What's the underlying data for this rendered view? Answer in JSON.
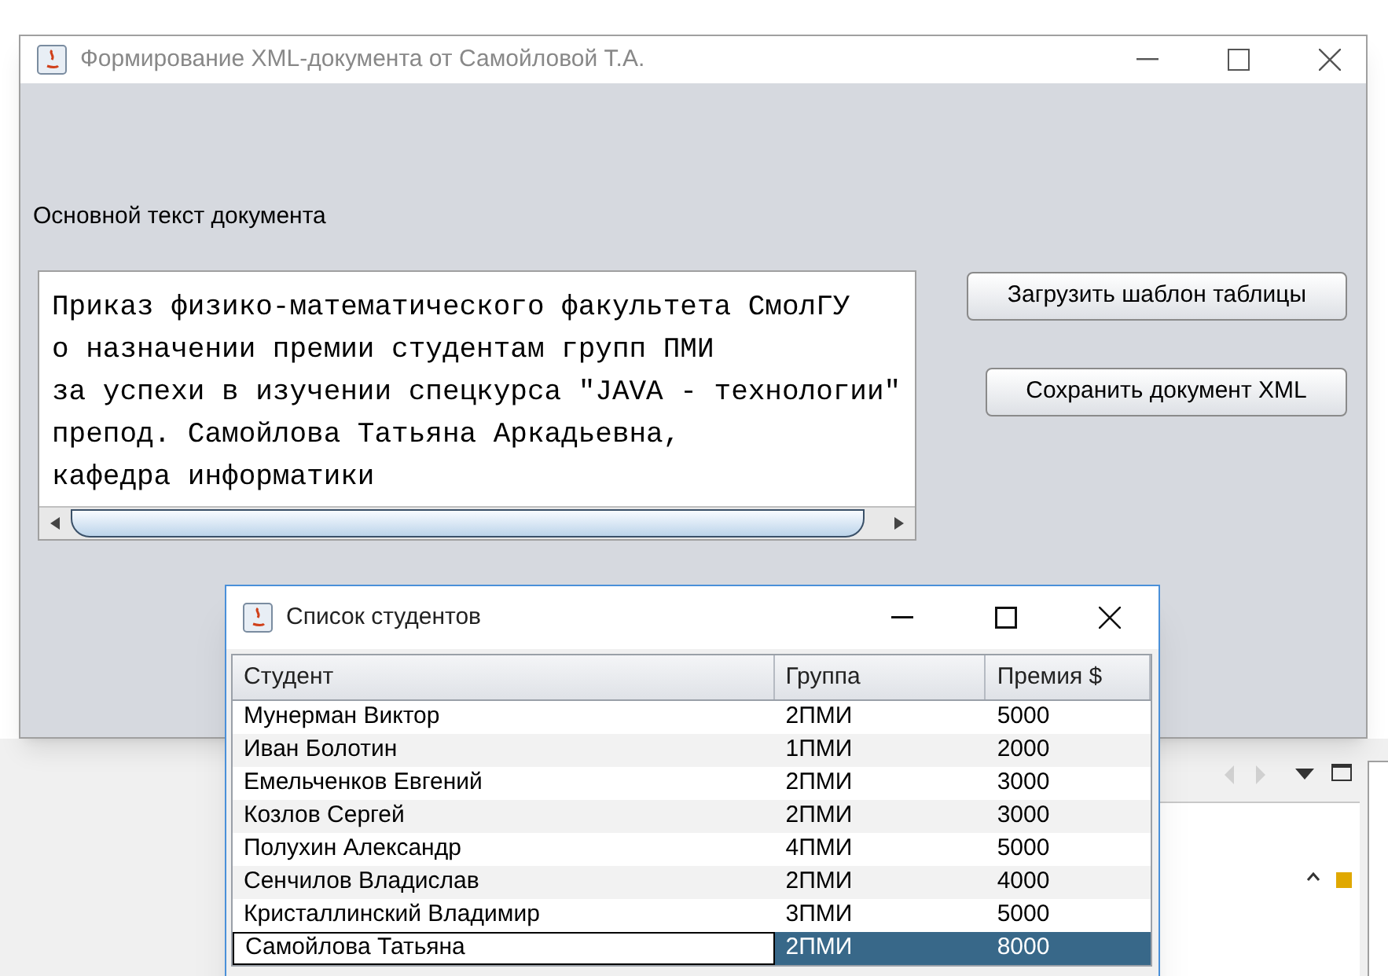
{
  "main_window": {
    "title": "Формирование XML-документа от Самойловой Т.А.",
    "text_label": "Основной текст документа",
    "document_lines": [
      "Приказ физико-математического факультета СмолГУ",
      "о назначении премии студентам групп ПМИ",
      "за успехи в изучении спецкурса \"JAVA - технологии\"",
      "препод. Самойлова Татьяна Аркадьевна,",
      "кафедра информатики"
    ],
    "buttons": [
      "Загрузить шаблон таблицы",
      "Сохранить документ XML"
    ]
  },
  "students_window": {
    "title": "Список студентов",
    "columns": [
      "Студент",
      "Группа",
      "Премия $"
    ],
    "rows": [
      {
        "cells": [
          "Мунерман Виктор",
          "2ПМИ",
          "5000"
        ],
        "selected": false
      },
      {
        "cells": [
          "Иван Болотин",
          "1ПМИ",
          "2000"
        ],
        "selected": false
      },
      {
        "cells": [
          "Емельченков Евгений",
          "2ПМИ",
          "3000"
        ],
        "selected": false
      },
      {
        "cells": [
          "Козлов Сергей",
          "2ПМИ",
          "3000"
        ],
        "selected": false
      },
      {
        "cells": [
          "Полухин Александр",
          "4ПМИ",
          "5000"
        ],
        "selected": false
      },
      {
        "cells": [
          "Сенчилов Владислав",
          "2ПМИ",
          "4000"
        ],
        "selected": false
      },
      {
        "cells": [
          "Кристаллинский Владимир",
          "3ПМИ",
          "5000"
        ],
        "selected": false
      },
      {
        "cells": [
          "Самойлова Татьяна",
          "2ПМИ",
          "8000"
        ],
        "selected": true
      }
    ]
  }
}
